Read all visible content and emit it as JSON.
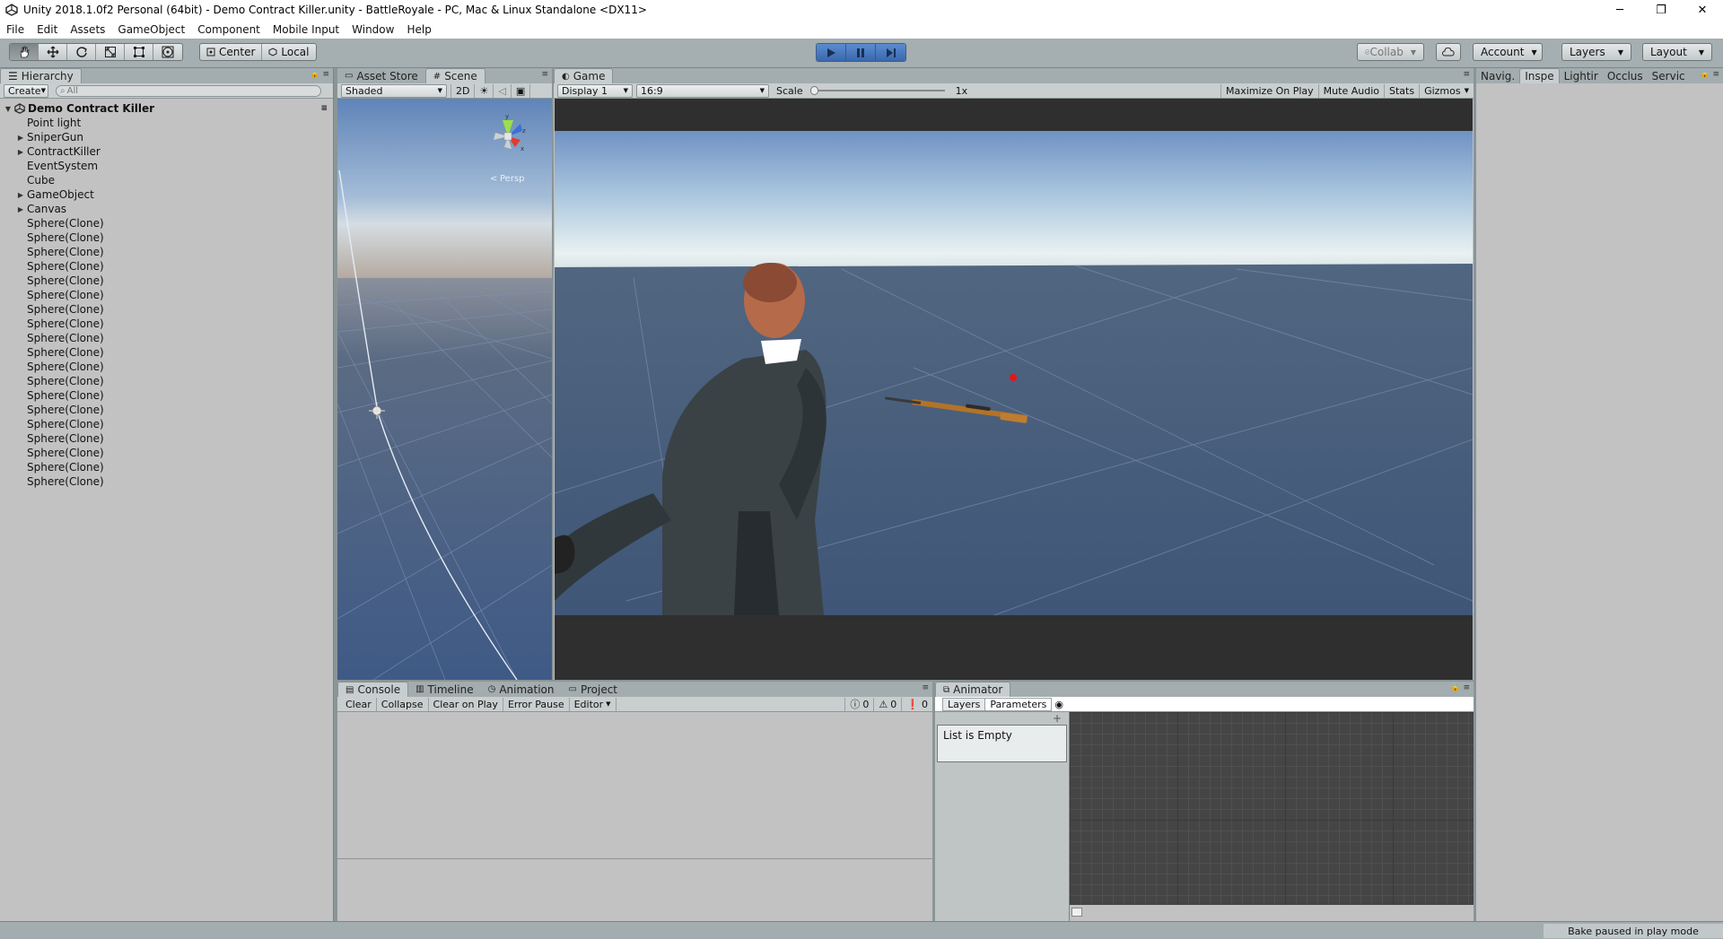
{
  "window": {
    "title": "Unity 2018.1.0f2 Personal (64bit) - Demo Contract Killer.unity - BattleRoyale - PC, Mac & Linux Standalone <DX11>",
    "minimize": "─",
    "restore": "❐",
    "close": "✕"
  },
  "menu": [
    "File",
    "Edit",
    "Assets",
    "GameObject",
    "Component",
    "Mobile Input",
    "Window",
    "Help"
  ],
  "toolbar": {
    "tools": [
      "hand-tool-icon",
      "move-tool-icon",
      "rotate-tool-icon",
      "scale-tool-icon",
      "rect-tool-icon",
      "transform-tool-icon"
    ],
    "pivot_label": "Center",
    "space_label": "Local",
    "collab_label": "Collab",
    "account_label": "Account",
    "layers_label": "Layers",
    "layout_label": "Layout",
    "accent": "#4a7bc4"
  },
  "hierarchy": {
    "tab_label": "Hierarchy",
    "create_label": "Create",
    "search_placeholder": "All",
    "scene_name": "Demo Contract Killer",
    "items": [
      {
        "label": "Point light",
        "has_children": false
      },
      {
        "label": "SniperGun",
        "has_children": true
      },
      {
        "label": "ContractKiller",
        "has_children": true
      },
      {
        "label": "EventSystem",
        "has_children": false
      },
      {
        "label": "Cube",
        "has_children": false
      },
      {
        "label": "GameObject",
        "has_children": true
      },
      {
        "label": "Canvas",
        "has_children": true
      },
      {
        "label": "Sphere(Clone)",
        "has_children": false
      },
      {
        "label": "Sphere(Clone)",
        "has_children": false
      },
      {
        "label": "Sphere(Clone)",
        "has_children": false
      },
      {
        "label": "Sphere(Clone)",
        "has_children": false
      },
      {
        "label": "Sphere(Clone)",
        "has_children": false
      },
      {
        "label": "Sphere(Clone)",
        "has_children": false
      },
      {
        "label": "Sphere(Clone)",
        "has_children": false
      },
      {
        "label": "Sphere(Clone)",
        "has_children": false
      },
      {
        "label": "Sphere(Clone)",
        "has_children": false
      },
      {
        "label": "Sphere(Clone)",
        "has_children": false
      },
      {
        "label": "Sphere(Clone)",
        "has_children": false
      },
      {
        "label": "Sphere(Clone)",
        "has_children": false
      },
      {
        "label": "Sphere(Clone)",
        "has_children": false
      },
      {
        "label": "Sphere(Clone)",
        "has_children": false
      },
      {
        "label": "Sphere(Clone)",
        "has_children": false
      },
      {
        "label": "Sphere(Clone)",
        "has_children": false
      },
      {
        "label": "Sphere(Clone)",
        "has_children": false
      },
      {
        "label": "Sphere(Clone)",
        "has_children": false
      },
      {
        "label": "Sphere(Clone)",
        "has_children": false
      }
    ]
  },
  "scene": {
    "tabs": [
      "Asset Store",
      "Scene"
    ],
    "shading_label": "Shaded",
    "mode_2d_label": "2D",
    "persp_label": "Persp",
    "gizmo_axes": {
      "x": "x",
      "y": "y",
      "z": "z"
    }
  },
  "game": {
    "tab_label": "Game",
    "display_label": "Display 1",
    "aspect_label": "16:9",
    "scale_label": "Scale",
    "scale_value": "1x",
    "maximize_label": "Maximize On Play",
    "mute_label": "Mute Audio",
    "stats_label": "Stats",
    "gizmos_label": "Gizmos"
  },
  "inspector_strip": {
    "tabs": [
      "Navig.",
      "Inspe",
      "Lightir",
      "Occlus",
      "Servic"
    ]
  },
  "console": {
    "tabs": [
      "Console",
      "Timeline",
      "Animation",
      "Project"
    ],
    "buttons": [
      "Clear",
      "Collapse",
      "Clear on Play",
      "Error Pause"
    ],
    "editor_label": "Editor",
    "info_count": "0",
    "warning_count": "0",
    "error_count": "0"
  },
  "animator": {
    "tab_label": "Animator",
    "layers_tab": "Layers",
    "parameters_tab": "Parameters",
    "add_label": "+",
    "empty_label": "List is Empty"
  },
  "status": {
    "bake": "Bake paused in play mode"
  }
}
